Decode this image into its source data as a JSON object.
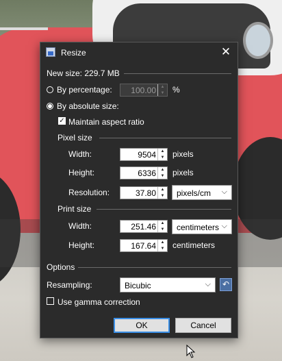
{
  "dialog": {
    "title": "Resize",
    "close_glyph": "✕",
    "new_size": "New size: 229.7 MB",
    "by_percentage": {
      "label": "By percentage:",
      "value": "100.00",
      "unit": "%",
      "selected": false
    },
    "by_absolute": {
      "label": "By absolute size:",
      "selected": true
    },
    "maintain_aspect": {
      "label": "Maintain aspect ratio",
      "checked": true
    },
    "pixel_size": {
      "heading": "Pixel size",
      "width_label": "Width:",
      "width_value": "9504",
      "width_unit": "pixels",
      "height_label": "Height:",
      "height_value": "6336",
      "height_unit": "pixels",
      "resolution_label": "Resolution:",
      "resolution_value": "37.80",
      "resolution_unit": "pixels/cm"
    },
    "print_size": {
      "heading": "Print size",
      "width_label": "Width:",
      "width_value": "251.46",
      "width_unit": "centimeters",
      "height_label": "Height:",
      "height_value": "167.64",
      "height_unit": "centimeters"
    },
    "options": {
      "heading": "Options",
      "resampling_label": "Resampling:",
      "resampling_value": "Bicubic",
      "gamma_label": "Use gamma correction",
      "gamma_checked": false
    },
    "ok_label": "OK",
    "cancel_label": "Cancel"
  },
  "icons": {
    "app": "resize-app-icon",
    "close": "close-icon",
    "spin_up": "▲",
    "spin_down": "▼",
    "dropdown": "⌵",
    "reset": "↶",
    "check": "✓"
  },
  "colors": {
    "dialog_bg": "#2b2b2b",
    "accent": "#3a8ee6",
    "reset_button": "#4b6fa3"
  }
}
